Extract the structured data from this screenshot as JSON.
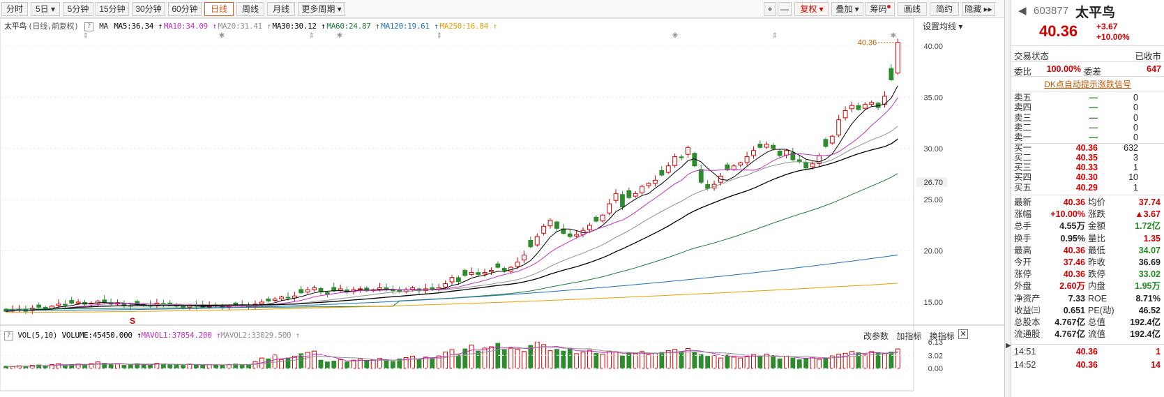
{
  "toolbar": {
    "periods": [
      "分时",
      "5日",
      "5分钟",
      "15分钟",
      "30分钟",
      "60分钟",
      "日线",
      "周线",
      "月线",
      "更多周期"
    ],
    "active_period": "日线",
    "right_buttons": {
      "plus": "+",
      "minus": "—",
      "fuquan": "复权",
      "overlay": "叠加",
      "chips": "筹码",
      "draw": "画线",
      "simple": "简约",
      "hide": "隐藏"
    }
  },
  "chart": {
    "stock_name": "太平鸟",
    "period_label": "(日线,前复权)",
    "ma_title": "MA",
    "ma_legend": [
      {
        "text": "MA5:36.34",
        "color": "#000000"
      },
      {
        "text": "MA10:34.09",
        "color": "#c030c0"
      },
      {
        "text": "MA20:31.41",
        "color": "#909090"
      },
      {
        "text": "MA30:30.12",
        "color": "#000000"
      },
      {
        "text": "MA60:24.87",
        "color": "#1e7a3a"
      },
      {
        "text": "MA120:19.61",
        "color": "#1e70b8"
      },
      {
        "text": "MA250:16.84",
        "color": "#e8a000"
      }
    ],
    "settings_label": "设置均线",
    "price_axis": [
      "40.00",
      "35.00",
      "30.00",
      "25.00",
      "20.00",
      "15.00"
    ],
    "current_price_label": "26.70",
    "last_price_tag": "40.36",
    "marker_s": "S",
    "vol_title": "VOL(5,10)",
    "vol_legend": [
      {
        "text": "VOLUME:45450.000",
        "color": "#000000"
      },
      {
        "text": "MAVOL1:37854.200",
        "color": "#c030c0"
      },
      {
        "text": "MAVOL2:33029.500",
        "color": "#909090"
      }
    ],
    "vol_axis": [
      "6.13",
      "3.02",
      "0.00"
    ],
    "vol_tools": {
      "params": "改参数",
      "add": "加指标",
      "switch": "换指标"
    }
  },
  "chart_data": {
    "type": "candlestick",
    "ylim": [
      13.5,
      41.5
    ],
    "closes": [
      14.1,
      14.2,
      14.3,
      14.1,
      14.4,
      14.5,
      14.3,
      14.6,
      14.8,
      14.7,
      14.9,
      15.0,
      14.8,
      14.9,
      15.1,
      15.0,
      14.8,
      14.9,
      14.7,
      14.6,
      14.8,
      14.7,
      14.6,
      14.9,
      14.8,
      14.7,
      14.6,
      14.5,
      14.7,
      14.6,
      14.5,
      14.7,
      14.6,
      14.5,
      14.6,
      14.7,
      14.6,
      14.5,
      14.8,
      15.0,
      15.1,
      15.3,
      15.5,
      15.4,
      15.6,
      15.9,
      16.2,
      16.4,
      16.0,
      15.8,
      16.1,
      16.3,
      16.0,
      16.2,
      16.3,
      16.1,
      16.2,
      16.4,
      16.3,
      16.1,
      16.0,
      16.2,
      16.4,
      16.1,
      16.3,
      16.2,
      16.4,
      16.8,
      17.4,
      17.0,
      17.6,
      17.9,
      17.7,
      17.9,
      18.1,
      18.4,
      18.0,
      18.4,
      18.9,
      19.6,
      20.4,
      21.4,
      22.4,
      23.0,
      22.2,
      21.7,
      21.4,
      21.6,
      22.0,
      22.5,
      22.9,
      23.5,
      24.6,
      25.6,
      24.3,
      25.2,
      25.6,
      26.3,
      26.6,
      26.9,
      27.4,
      28.3,
      29.2,
      29.1,
      30.1,
      28.3,
      26.7,
      26.1,
      26.5,
      27.3,
      27.9,
      28.3,
      28.6,
      29.2,
      29.8,
      30.1,
      30.4,
      30.0,
      29.3,
      29.8,
      28.9,
      28.7,
      28.1,
      28.5,
      29.3,
      30.2,
      31.2,
      32.8,
      33.7,
      34.2,
      33.8,
      34.3,
      34.5,
      34.0,
      35.1,
      36.7,
      40.36
    ],
    "volumes": [
      0.5,
      0.4,
      0.6,
      0.5,
      0.7,
      0.8,
      0.6,
      0.9,
      1.1,
      0.8,
      0.9,
      1.0,
      0.8,
      1.1,
      1.5,
      1.2,
      0.9,
      1.0,
      0.7,
      0.8,
      1.1,
      0.9,
      0.8,
      1.2,
      1.0,
      0.9,
      0.8,
      0.7,
      1.0,
      0.8,
      0.7,
      0.9,
      0.8,
      0.8,
      0.9,
      1.0,
      0.9,
      0.8,
      1.6,
      2.4,
      2.2,
      3.1,
      2.0,
      2.4,
      2.8,
      3.4,
      3.7,
      4.0,
      1.9,
      1.5,
      1.7,
      2.0,
      1.5,
      1.9,
      2.2,
      1.7,
      2.0,
      2.3,
      1.9,
      1.6,
      2.2,
      2.5,
      2.8,
      2.1,
      2.6,
      2.4,
      2.9,
      3.8,
      4.3,
      3.1,
      4.5,
      5.4,
      4.0,
      4.7,
      5.0,
      5.8,
      4.3,
      4.7,
      4.4,
      3.9,
      5.3,
      6.1,
      5.5,
      4.1,
      4.4,
      4.0,
      4.6,
      3.4,
      3.8,
      4.2,
      3.5,
      3.3,
      4.0,
      3.8,
      2.9,
      3.6,
      3.4,
      3.9,
      3.2,
      3.5,
      3.7,
      4.1,
      4.4,
      3.9,
      4.6,
      3.8,
      3.2,
      2.8,
      3.0,
      2.4,
      3.1,
      2.6,
      2.4,
      2.8,
      3.2,
      2.9,
      3.3,
      2.7,
      2.2,
      2.8,
      2.4,
      2.0,
      2.3,
      2.6,
      2.1,
      2.4,
      2.9,
      3.3,
      3.5,
      3.9,
      3.6,
      3.2,
      3.9,
      3.6,
      3.4,
      3.8,
      4.5
    ],
    "ma_series": [
      "MA5",
      "MA10",
      "MA20",
      "MA30",
      "MA60",
      "MA120",
      "MA250"
    ],
    "vol_ylim": [
      0,
      6.13
    ]
  },
  "panel": {
    "code": "603877",
    "name": "太平鸟",
    "price": "40.36",
    "change": "+3.67",
    "change_pct": "+10.00%",
    "trade_status_label": "交易状态",
    "trade_status": "已收市",
    "webi_label": "委比",
    "webi": "100.00%",
    "weicha_label": "委差",
    "weicha": "647",
    "dk_link": "DK点自动提示涨跌信号",
    "sell": [
      {
        "label": "卖五",
        "price": "—",
        "vol": "0"
      },
      {
        "label": "卖四",
        "price": "—",
        "vol": "0"
      },
      {
        "label": "卖三",
        "price": "—",
        "vol": "0"
      },
      {
        "label": "卖二",
        "price": "—",
        "vol": "0"
      },
      {
        "label": "卖一",
        "price": "—",
        "vol": "0"
      }
    ],
    "buy": [
      {
        "label": "买一",
        "price": "40.36",
        "vol": "632"
      },
      {
        "label": "买二",
        "price": "40.35",
        "vol": "3"
      },
      {
        "label": "买三",
        "price": "40.33",
        "vol": "1"
      },
      {
        "label": "买四",
        "price": "40.30",
        "vol": "10"
      },
      {
        "label": "买五",
        "price": "40.29",
        "vol": "1"
      }
    ],
    "stats": [
      {
        "l1": "最新",
        "v1": "40.36",
        "c1": "up",
        "l2": "均价",
        "v2": "37.74",
        "c2": "up"
      },
      {
        "l1": "涨幅",
        "v1": "+10.00%",
        "c1": "up",
        "l2": "涨跌",
        "v2": "▲3.67",
        "c2": "up"
      },
      {
        "l1": "总手",
        "v1": "4.55万",
        "c1": "",
        "l2": "金额",
        "v2": "1.72亿",
        "c2": "dn"
      },
      {
        "l1": "换手",
        "v1": "0.95%",
        "c1": "",
        "l2": "量比",
        "v2": "1.35",
        "c2": "up"
      },
      {
        "l1": "最高",
        "v1": "40.36",
        "c1": "up",
        "l2": "最低",
        "v2": "34.07",
        "c2": "dn"
      },
      {
        "l1": "今开",
        "v1": "37.46",
        "c1": "up",
        "l2": "昨收",
        "v2": "36.69",
        "c2": ""
      },
      {
        "l1": "涨停",
        "v1": "40.36",
        "c1": "up",
        "l2": "跌停",
        "v2": "33.02",
        "c2": "dn"
      },
      {
        "l1": "外盘",
        "v1": "2.60万",
        "c1": "up",
        "l2": "内盘",
        "v2": "1.95万",
        "c2": "dn"
      },
      {
        "l1": "净资产",
        "v1": "7.33",
        "c1": "",
        "l2": "ROE",
        "v2": "8.71%",
        "c2": ""
      },
      {
        "l1": "收益㈢",
        "v1": "0.651",
        "c1": "",
        "l2": "PE(动)",
        "v2": "46.52",
        "c2": ""
      },
      {
        "l1": "总股本",
        "v1": "4.767亿",
        "c1": "",
        "l2": "总值",
        "v2": "192.4亿",
        "c2": ""
      },
      {
        "l1": "流通股",
        "v1": "4.767亿",
        "c1": "",
        "l2": "流值",
        "v2": "192.4亿",
        "c2": ""
      }
    ],
    "ticks": [
      {
        "time": "14:51",
        "price": "40.36",
        "vol": "1"
      },
      {
        "time": "14:52",
        "price": "40.36",
        "vol": "14"
      }
    ]
  },
  "colors": {
    "up": "#d40000",
    "down": "#228b22",
    "accent": "#e35a1b"
  },
  "icons": {
    "prev": "triangle-left-icon",
    "collapse": "triangle-right-icon"
  }
}
